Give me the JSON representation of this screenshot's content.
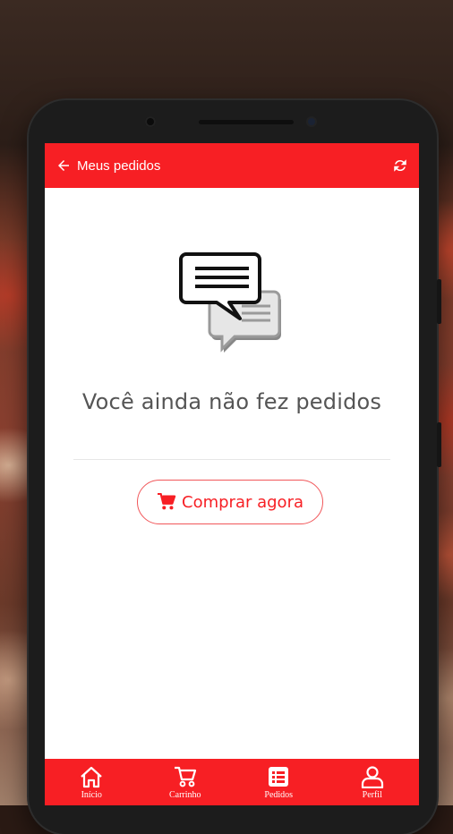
{
  "appbar": {
    "title": "Meus pedidos",
    "back_icon": "arrow-left-icon",
    "refresh_icon": "refresh-icon"
  },
  "empty_state": {
    "icon": "chat-bubbles-icon",
    "message": "Você ainda não fez pedidos",
    "button_label": "Comprar agora",
    "button_icon": "cart-icon"
  },
  "bottom_nav": {
    "items": [
      {
        "label": "Início",
        "icon": "home-icon"
      },
      {
        "label": "Carrinho",
        "icon": "cart-icon"
      },
      {
        "label": "Pedidos",
        "icon": "list-icon",
        "active": true
      },
      {
        "label": "Perfil",
        "icon": "user-icon"
      }
    ]
  },
  "colors": {
    "accent": "#f71f24",
    "text": "#555555"
  }
}
